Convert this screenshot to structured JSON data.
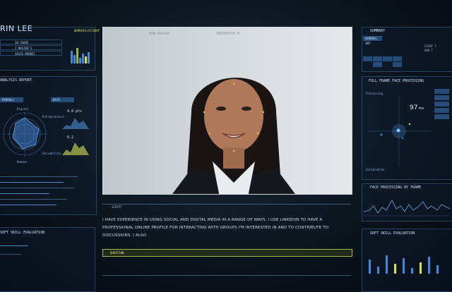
{
  "candidate": {
    "name": "RIN LEE",
    "tag": "NUMBERS/ACCOUNT",
    "list": [
      "20 YEARS",
      "I MASTER'S",
      "SALES MARKET"
    ]
  },
  "left_panels": {
    "analysis_title": "ANALYSIS REPORT",
    "sub_a": "OVERALL",
    "sub_b": "DATA",
    "radar_labels": [
      "Digital",
      "Entrepreneurs",
      "Humans",
      "Sociability"
    ],
    "metric_value_a": "4.0 pts",
    "metric_value_b": "6.2",
    "soft_skill_title": "SOFT SKILL EVALUATION"
  },
  "video": {
    "header_left": "MIND RELATED",
    "header_center": "INTERVIEW M"
  },
  "transcript": {
    "label": "SCRIPT",
    "text": "I HAVE EXPERIENCE IN USING SOCIAL AND DIGITAL MEDIA IN A RANGE OF WAYS. I USE LINKEDIN TO HAVE A PROFESSIONAL ONLINE PROFILE FOR INTERACTING WITH GROUPS I'M INTERESTED IN AND TO CONTRIBUTE TO DISCUSSIONS. I ALSO"
  },
  "question": {
    "label": "QUESTION"
  },
  "right_panels": {
    "summary_title": "SUMMARY",
    "summary_badge": "GENERAL INT",
    "summary_start": "START T",
    "summary_end": "END T",
    "face_title": "FULL FRAME FACE PROCESSING",
    "face_value": "97",
    "face_unit": "ms",
    "face_top": "Processing",
    "face_bottom": "Calibration",
    "freq_title": "FACE PROCESSING BY FRAME",
    "soft_title": "SOFT SKILL EVALUATION"
  },
  "colors": {
    "accent_blue": "#3f7fc4",
    "accent_yellow": "#d7df5a",
    "text_light": "#c9dff2"
  }
}
